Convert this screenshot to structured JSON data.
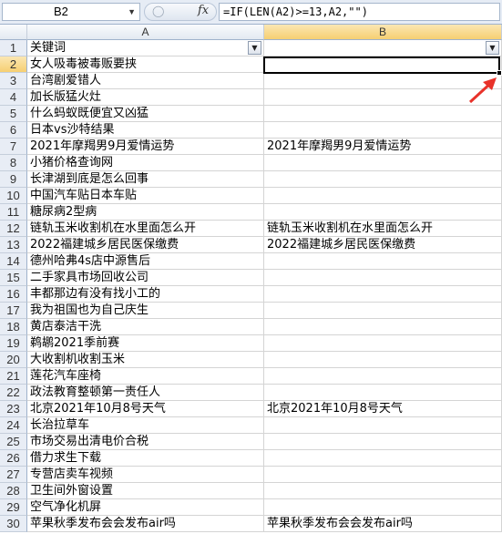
{
  "name_box": {
    "value": "B2"
  },
  "formula_bar": {
    "fx_label": "fx",
    "formula": "=IF(LEN(A2)>=13,A2,\"\")"
  },
  "columns": [
    "A",
    "B"
  ],
  "rows": [
    {
      "n": "1",
      "a": "关键词",
      "b": ""
    },
    {
      "n": "2",
      "a": "女人吸毒被毒贩要挟",
      "b": ""
    },
    {
      "n": "3",
      "a": "台湾剧爱错人",
      "b": ""
    },
    {
      "n": "4",
      "a": "加长版猛火灶",
      "b": ""
    },
    {
      "n": "5",
      "a": "什么蚂蚁既便宜又凶猛",
      "b": ""
    },
    {
      "n": "6",
      "a": "日本vs沙特结果",
      "b": ""
    },
    {
      "n": "7",
      "a": "2021年摩羯男9月爱情运势",
      "b": "2021年摩羯男9月爱情运势"
    },
    {
      "n": "8",
      "a": "小猪价格查询网",
      "b": ""
    },
    {
      "n": "9",
      "a": "长津湖到底是怎么回事",
      "b": ""
    },
    {
      "n": "10",
      "a": "中国汽车贴日本车贴",
      "b": ""
    },
    {
      "n": "11",
      "a": "糖尿病2型病",
      "b": ""
    },
    {
      "n": "12",
      "a": "链轨玉米收割机在水里面怎么开",
      "b": "链轨玉米收割机在水里面怎么开"
    },
    {
      "n": "13",
      "a": "2022福建城乡居民医保缴费",
      "b": "2022福建城乡居民医保缴费"
    },
    {
      "n": "14",
      "a": "德州哈弗4s店中源售后",
      "b": ""
    },
    {
      "n": "15",
      "a": "二手家具市场回收公司",
      "b": ""
    },
    {
      "n": "16",
      "a": "丰都那边有没有找小工的",
      "b": ""
    },
    {
      "n": "17",
      "a": "我为祖国也为自己庆生",
      "b": ""
    },
    {
      "n": "18",
      "a": "黄店泰洁干洗",
      "b": ""
    },
    {
      "n": "19",
      "a": "鹈鹕2021季前赛",
      "b": ""
    },
    {
      "n": "20",
      "a": "大收割机收割玉米",
      "b": ""
    },
    {
      "n": "21",
      "a": "莲花汽车座椅",
      "b": ""
    },
    {
      "n": "22",
      "a": "政法教育整顿第一责任人",
      "b": ""
    },
    {
      "n": "23",
      "a": "北京2021年10月8号天气",
      "b": "北京2021年10月8号天气"
    },
    {
      "n": "24",
      "a": "长治拉草车",
      "b": ""
    },
    {
      "n": "25",
      "a": "市场交易出清电价合税",
      "b": ""
    },
    {
      "n": "26",
      "a": "借力求生下载",
      "b": ""
    },
    {
      "n": "27",
      "a": "专营店卖车视频",
      "b": ""
    },
    {
      "n": "28",
      "a": "卫生间外窗设置",
      "b": ""
    },
    {
      "n": "29",
      "a": "空气净化机屏",
      "b": ""
    },
    {
      "n": "30",
      "a": "苹果秋季发布会会发布air吗",
      "b": "苹果秋季发布会会发布air吗"
    }
  ],
  "colors": {
    "selection_header": "#f6cf72",
    "arrow": "#e8322a"
  }
}
